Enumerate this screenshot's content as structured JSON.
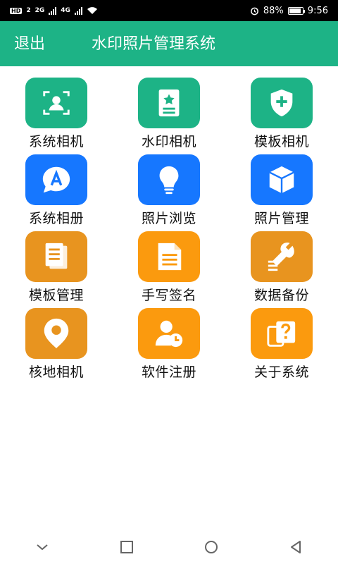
{
  "status_bar": {
    "left_badge": "HD",
    "left_badge2": "2",
    "net1": "2G",
    "net2": "4G",
    "battery_percent_text": "88%",
    "battery_level": 0.88,
    "time": "9:56"
  },
  "header": {
    "exit_label": "退出",
    "title": "水印照片管理系统",
    "background": "#1db386"
  },
  "tiles": [
    {
      "label": "系统相机",
      "icon": "camera-face-icon",
      "color": "#1db386"
    },
    {
      "label": "水印相机",
      "icon": "document-star-icon",
      "color": "#1db386"
    },
    {
      "label": "模板相机",
      "icon": "shield-plus-icon",
      "color": "#1db386"
    },
    {
      "label": "系统相册",
      "icon": "chat-a-icon",
      "color": "#1677ff"
    },
    {
      "label": "照片浏览",
      "icon": "lightbulb-icon",
      "color": "#1677ff"
    },
    {
      "label": "照片管理",
      "icon": "cube-icon",
      "color": "#1677ff"
    },
    {
      "label": "模板管理",
      "icon": "documents-icon",
      "color": "#e8941f"
    },
    {
      "label": "手写签名",
      "icon": "file-lines-icon",
      "color": "#fb9a0e"
    },
    {
      "label": "数据备份",
      "icon": "wrench-icon",
      "color": "#e8941f"
    },
    {
      "label": "核地相机",
      "icon": "map-pin-icon",
      "color": "#e8941f"
    },
    {
      "label": "软件注册",
      "icon": "user-clock-icon",
      "color": "#fb9a0e"
    },
    {
      "label": "关于系统",
      "icon": "question-card-icon",
      "color": "#fb9a0e"
    }
  ],
  "nav_bar": {
    "back": "back-triangle-icon",
    "home": "home-circle-icon",
    "recents": "recents-square-icon",
    "down": "chevron-down-icon"
  }
}
